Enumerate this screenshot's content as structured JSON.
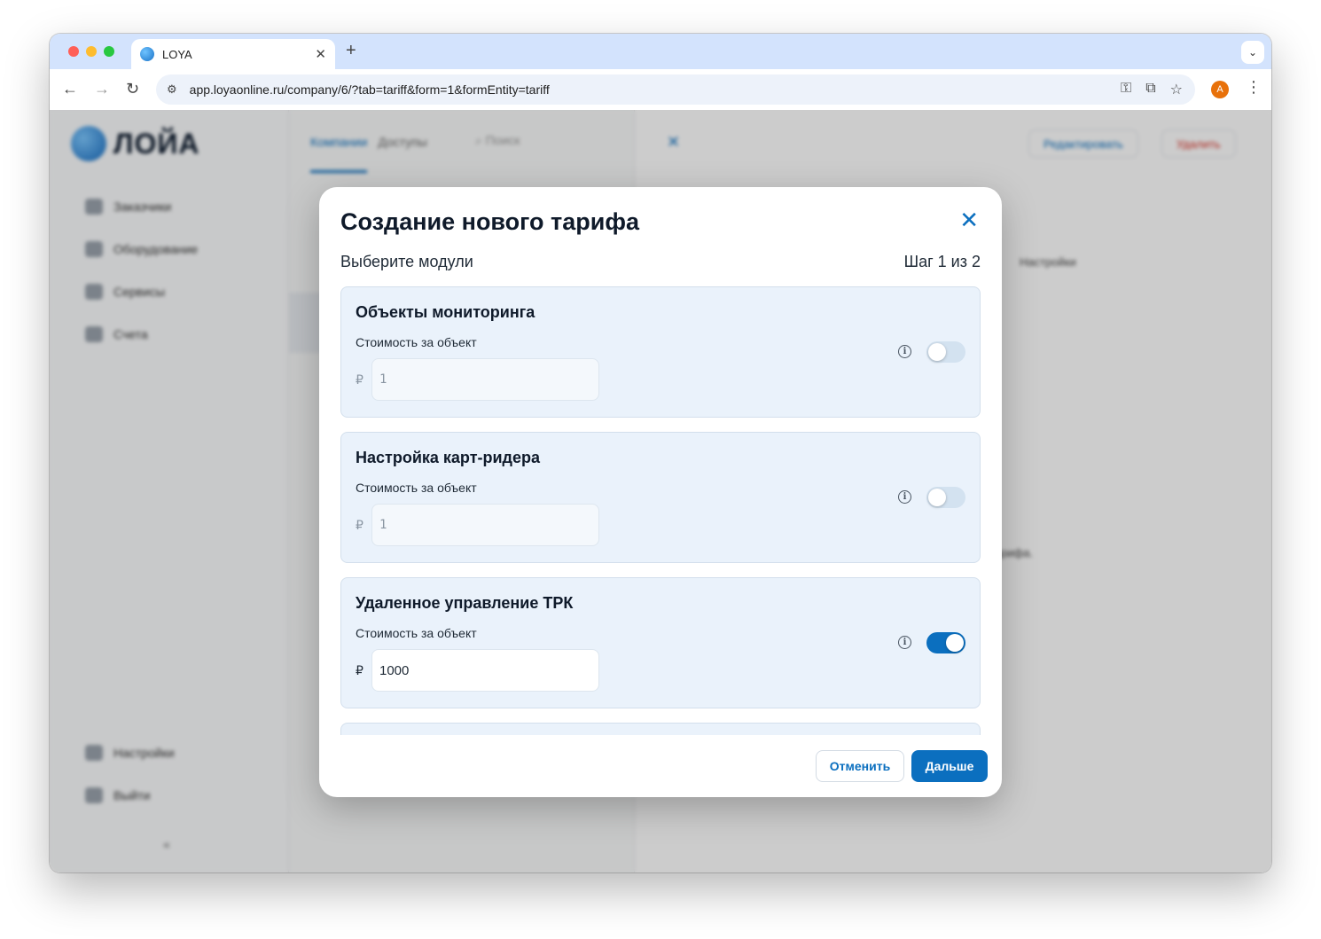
{
  "browser": {
    "tab_title": "LOYA",
    "tab_close": "✕",
    "new_tab": "+",
    "url": "app.loyaonline.ru/company/6/?tab=tariff&form=1&formEntity=tariff",
    "avatar_letter": "A"
  },
  "background_app": {
    "logo_text": "ЛОЙА",
    "sidebar_items": [
      "Заказчики",
      "Оборудование",
      "Сервисы",
      "Счета"
    ],
    "sidebar_bottom_items": [
      "Настройки",
      "Выйти"
    ],
    "mid_tabs": [
      "Компании",
      "Доступы"
    ],
    "search_placeholder": "Поиск",
    "edit_label": "Редактировать",
    "delete_label": "Удалить",
    "settings_tab": "Настройки",
    "right_text": "тарифа."
  },
  "modal": {
    "title": "Создание нового тарифа",
    "subtitle": "Выберите модули",
    "step": "Шаг 1 из 2",
    "modules": [
      {
        "title": "Объекты мониторинга",
        "price_label": "Стоимость за объект",
        "currency": "₽",
        "value": "1",
        "enabled": false
      },
      {
        "title": "Настройка карт-ридера",
        "price_label": "Стоимость за объект",
        "currency": "₽",
        "value": "1",
        "enabled": false
      },
      {
        "title": "Удаленное управление ТРК",
        "price_label": "Стоимость за объект",
        "currency": "₽",
        "value": "1000",
        "enabled": true
      }
    ],
    "cancel_label": "Отменить",
    "next_label": "Дальше"
  },
  "colors": {
    "accent": "#0b6fbf",
    "module_bg": "#eaf2fb",
    "danger": "#d93025"
  }
}
